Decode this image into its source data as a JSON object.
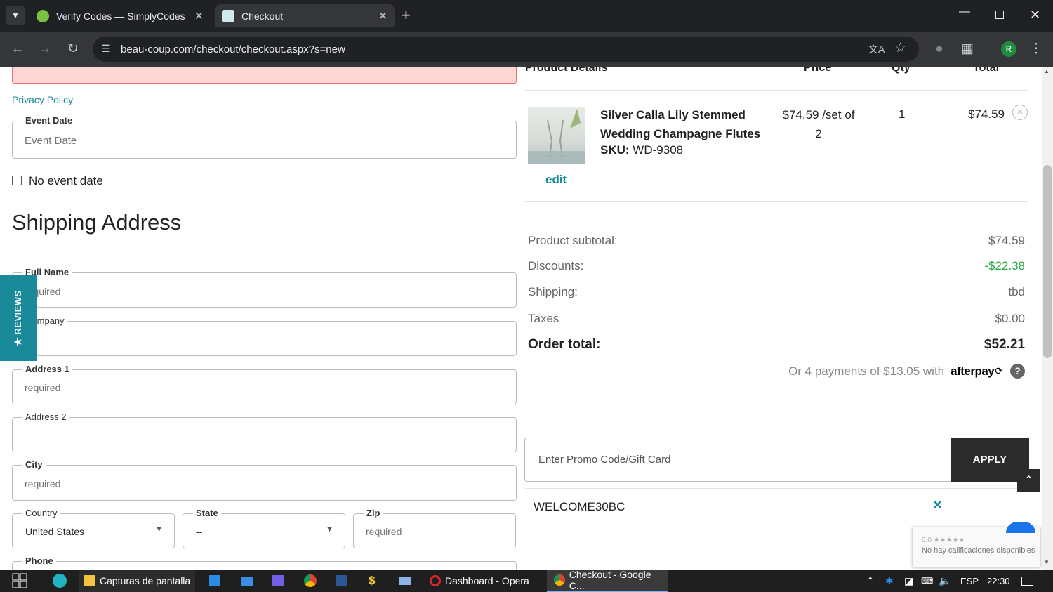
{
  "browser": {
    "tabs": [
      {
        "title": "Verify Codes — SimplyCodes"
      },
      {
        "title": "Checkout"
      }
    ],
    "url": "beau-coup.com/checkout/checkout.aspx?s=new"
  },
  "form": {
    "privacy_link": "Privacy Policy",
    "event_date": {
      "label": "Event Date",
      "placeholder": "Event Date"
    },
    "no_event_date": "No event date",
    "shipping_title": "Shipping Address",
    "full_name": {
      "label": "Full Name",
      "placeholder": "required"
    },
    "company": {
      "label": "Company",
      "placeholder": ""
    },
    "address1": {
      "label": "Address 1",
      "placeholder": "required"
    },
    "address2": {
      "label": "Address 2",
      "placeholder": ""
    },
    "city": {
      "label": "City",
      "placeholder": "required"
    },
    "country": {
      "label": "Country",
      "value": "United States"
    },
    "state": {
      "label": "State",
      "value": "--"
    },
    "zip": {
      "label": "Zip",
      "placeholder": "required"
    },
    "phone": {
      "label": "Phone"
    }
  },
  "reviews_tab": "★ REVIEWS",
  "cart": {
    "headers": {
      "product": "Product Details",
      "price": "Price",
      "qty": "Qty",
      "total": "Total"
    },
    "item": {
      "name": "Silver Calla Lily Stemmed Wedding Champagne Flutes",
      "sku_label": "SKU:",
      "sku": "WD-9308",
      "price": "$74.59 /set of 2",
      "qty": "1",
      "total": "$74.59",
      "edit": "edit"
    },
    "summary": {
      "subtotal_label": "Product subtotal:",
      "subtotal": "$74.59",
      "discounts_label": "Discounts:",
      "discounts": "-$22.38",
      "shipping_label": "Shipping:",
      "shipping": "tbd",
      "taxes_label": "Taxes",
      "taxes": "$0.00",
      "order_total_label": "Order total:",
      "order_total": "$52.21"
    },
    "afterpay_text": "Or 4 payments of $13.05 with",
    "afterpay_brand": "afterpay",
    "promo_placeholder": "Enter Promo Code/Gift Card",
    "apply_label": "APPLY",
    "applied_code": "WELCOME30BC"
  },
  "recaptcha": {
    "rating": "0.0 ★★★★★",
    "text": "No hay calificaciones disponibles"
  },
  "taskbar": {
    "items": [
      "Capturas de pantalla",
      "Dashboard - Opera",
      "Checkout - Google C..."
    ],
    "lang": "ESP",
    "time": "22:30"
  },
  "colors": {
    "accent": "#1a8a9a",
    "discount": "#27a845",
    "error_bg": "#ffd6d6",
    "error_border": "#e57373"
  }
}
